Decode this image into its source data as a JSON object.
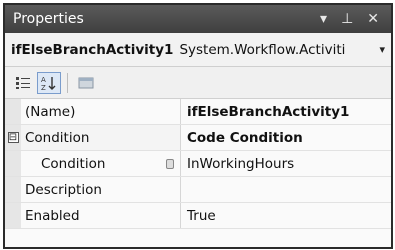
{
  "window": {
    "title": "Properties",
    "controls": {
      "dropdown": "▾",
      "pin": "⊥",
      "close": "✕"
    }
  },
  "object_selector": {
    "name": "ifElseBranchActivity1",
    "type": "System.Workflow.Activiti",
    "dropdown_arrow": "▾"
  },
  "toolbar": {
    "buttons": [
      "categorized-icon",
      "alphabetical-icon",
      "property-pages-icon"
    ]
  },
  "properties": [
    {
      "name": "(Name)",
      "value": "ifElseBranchActivity1",
      "value_bold": true
    },
    {
      "name": "Condition",
      "value": "Code Condition",
      "value_bold": true,
      "expander": "⊟"
    },
    {
      "name": "Condition",
      "value": "InWorkingHours",
      "value_bold": false
    },
    {
      "name": "Description",
      "value": "",
      "value_bold": false
    },
    {
      "name": "Enabled",
      "value": "True",
      "value_bold": false
    }
  ]
}
